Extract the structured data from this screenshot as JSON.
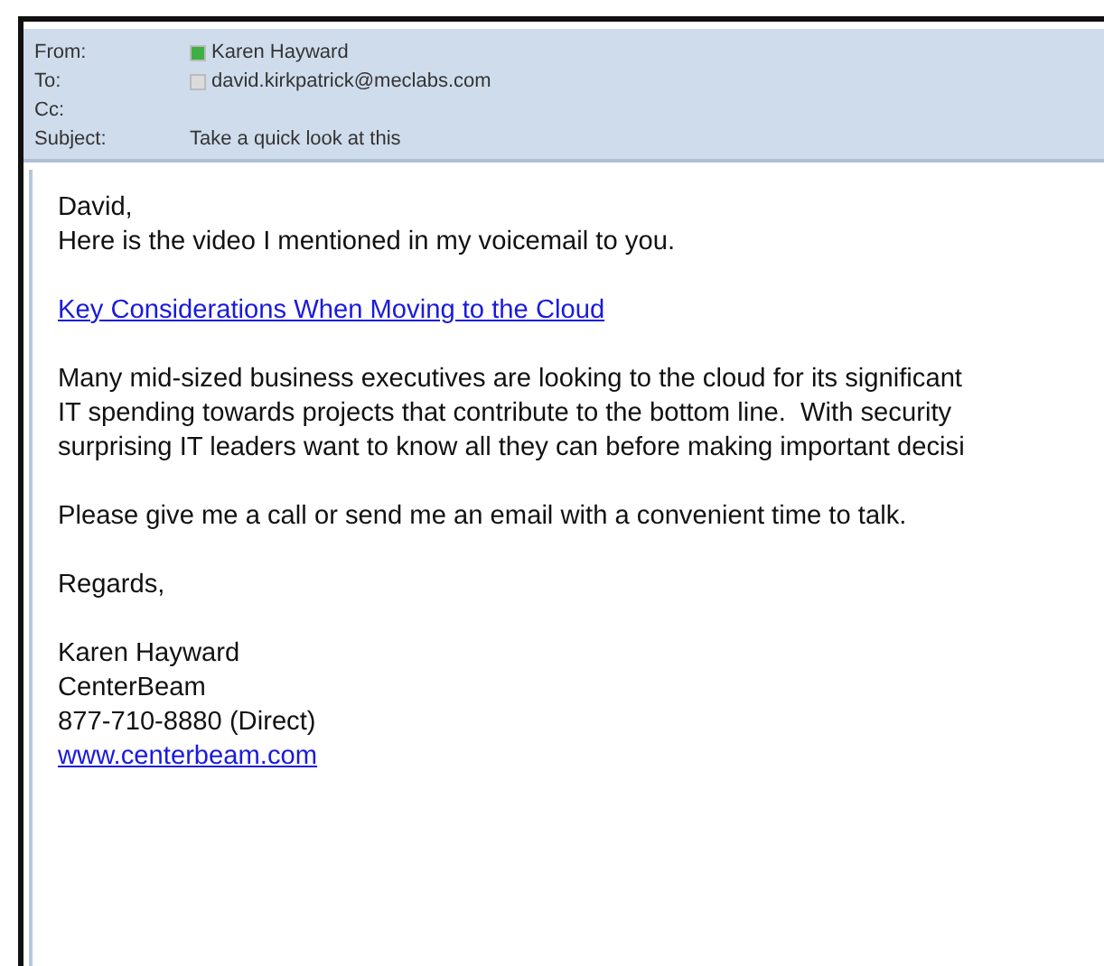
{
  "header": {
    "fields": [
      {
        "label": "From:",
        "value": "Karen Hayward",
        "color": "#3cb043"
      },
      {
        "label": "To:",
        "value": "david.kirkpatrick@meclabs.com",
        "color": "#dcdcdc"
      },
      {
        "label": "Cc:"
      },
      {
        "label": "Subject:",
        "value": "Take a quick look at this"
      }
    ]
  },
  "body": {
    "blocks": [
      {
        "kind": "text",
        "lines": [
          "David,",
          "Here is the video I mentioned in my voicemail to you."
        ]
      },
      {
        "kind": "link",
        "lines": [
          "Key Considerations When Moving to the Cloud"
        ]
      },
      {
        "kind": "text",
        "lines": [
          "Many mid-sized business executives are looking to the cloud for its significant",
          "IT spending towards projects that contribute to the bottom line.  With security",
          "surprising IT leaders want to know all they can before making important decisi"
        ]
      },
      {
        "kind": "text",
        "lines": [
          "Please give me a call or send me an email with a convenient time to talk."
        ]
      },
      {
        "kind": "text",
        "lines": [
          "Regards,"
        ]
      },
      {
        "kind": "signature",
        "lines": [
          "Karen Hayward",
          "CenterBeam",
          "877-710-8880 (Direct)"
        ],
        "link": "www.centerbeam.com"
      }
    ]
  }
}
